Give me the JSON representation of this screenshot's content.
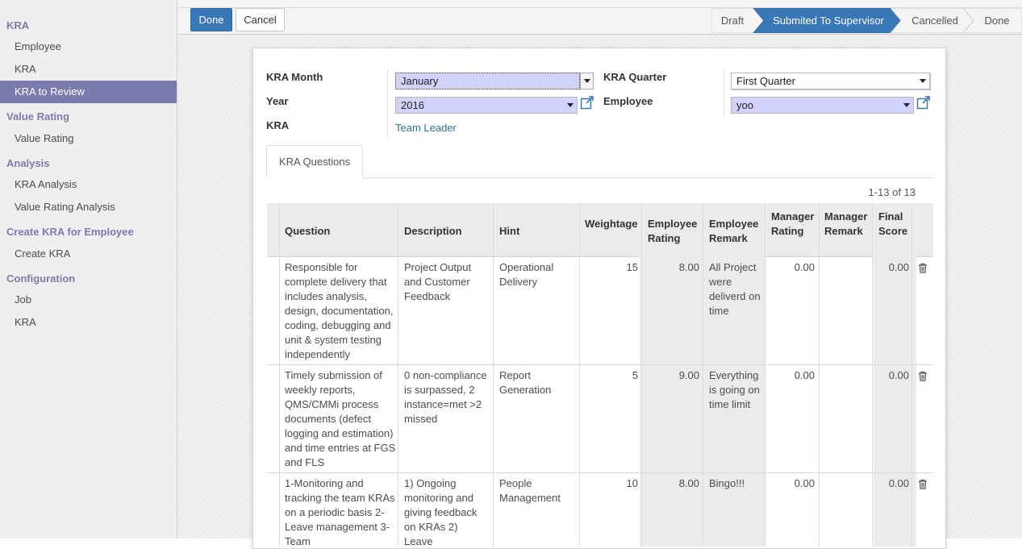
{
  "sidebar": {
    "sections": [
      {
        "title": "KRA",
        "items": [
          "Employee",
          "KRA",
          "KRA to Review"
        ]
      },
      {
        "title": "Value Rating",
        "items": [
          "Value Rating"
        ]
      },
      {
        "title": "Analysis",
        "items": [
          "KRA Analysis",
          "Value Rating Analysis"
        ]
      },
      {
        "title": "Create KRA for Employee",
        "items": [
          "Create KRA"
        ]
      },
      {
        "title": "Configuration",
        "items": [
          "Job",
          "KRA"
        ]
      }
    ],
    "active_item": "KRA to Review"
  },
  "toolbar": {
    "done_label": "Done",
    "cancel_label": "Cancel"
  },
  "statusbar": {
    "stages": [
      "Draft",
      "Submited To Supervisor",
      "Cancelled",
      "Done"
    ],
    "current": "Submited To Supervisor",
    "current_color": "#3a77b6"
  },
  "form": {
    "kra_month_label": "KRA Month",
    "kra_month_value": "January",
    "year_label": "Year",
    "year_value": "2016",
    "kra_label": "KRA",
    "kra_value": "Team Leader",
    "kra_quarter_label": "KRA Quarter",
    "kra_quarter_value": "First Quarter",
    "employee_label": "Employee",
    "employee_value": "yoo"
  },
  "tabs": {
    "questions_label": "KRA Questions"
  },
  "pager": "1-13 of 13",
  "table": {
    "headers": {
      "question": "Question",
      "description": "Description",
      "hint": "Hint",
      "weightage": "Weightage",
      "employee_rating": "Employee Rating",
      "employee_remark": "Employee Remark",
      "manager_rating": "Manager Rating",
      "manager_remark": "Manager Remark",
      "final_score": "Final Score"
    },
    "rows": [
      {
        "question": "Responsible for complete delivery that includes analysis, design, documentation, coding, debugging and unit & system testing independently",
        "description": "Project Output and Customer Feedback",
        "hint": "Operational Delivery",
        "weightage": "15",
        "employee_rating": "8.00",
        "employee_remark": "All Project were deliverd on time",
        "manager_rating": "0.00",
        "manager_remark": "",
        "final_score": "0.00"
      },
      {
        "question": "Timely submission of weekly reports, QMS/CMMi process documents (defect logging and estimation) and time entries at FGS and FLS",
        "description": "0 non-compliance is surpassed, 2 instance=met >2 missed",
        "hint": "Report Generation",
        "weightage": "5",
        "employee_rating": "9.00",
        "employee_remark": "Everything is going on time limit",
        "manager_rating": "0.00",
        "manager_remark": "",
        "final_score": "0.00"
      },
      {
        "question": "1-Monitoring and tracking the team KRAs on a periodic basis 2-Leave management 3-Team",
        "description": "1) Ongoing monitoring and giving feedback on KRAs 2) Leave",
        "hint": "People Management",
        "weightage": "10",
        "employee_rating": "8.00",
        "employee_remark": "Bingo!!!",
        "manager_rating": "0.00",
        "manager_remark": "",
        "final_score": "0.00"
      }
    ]
  }
}
